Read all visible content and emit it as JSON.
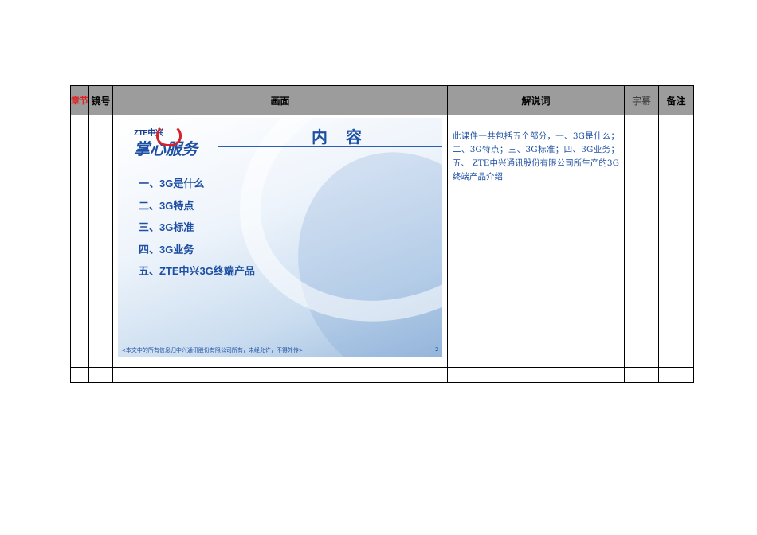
{
  "header": {
    "chapter": "章节",
    "shot": "镜号",
    "scene": "画面",
    "narration": "解说词",
    "subtitle": "字幕",
    "remarks": "备注"
  },
  "slide": {
    "logo_text": "ZTE中兴",
    "brand": "掌心服务",
    "title": "内 容",
    "toc": [
      "一、3G是什么",
      "二、3G特点",
      "三、3G标准",
      "四、3G业务",
      "五、ZTE中兴3G终端产品"
    ],
    "footer": "<本文中的所有信息归中兴通讯股份有限公司所有，未经允许，不得外传>",
    "page_number": "2",
    "colors": {
      "accent": "#1d4fa3",
      "logo_red": "#d8222a"
    }
  },
  "narration_text": "此课件一共包括五个部分，一、3G是什么；二、3G特点；三、3G标准；四、3G业务；五、 ZTE中兴通讯股份有限公司所生产的3G终端产品介绍",
  "colors": {
    "header_bg": "#9c9c9c",
    "chapter_text": "#e0201f"
  }
}
